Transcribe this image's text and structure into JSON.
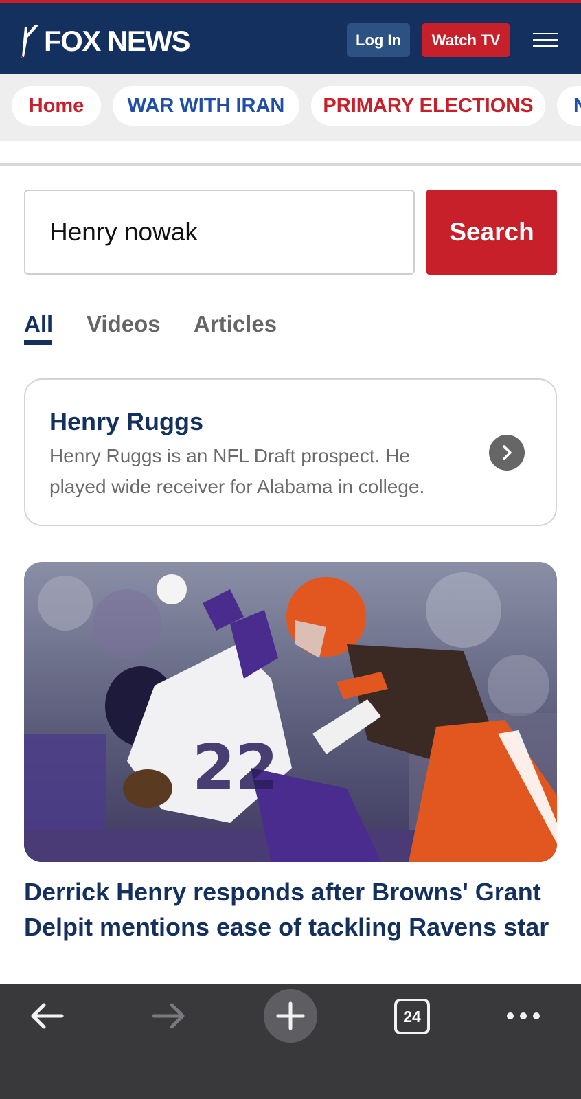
{
  "header": {
    "logo_text": "FOX NEWS",
    "login_label": "Log In",
    "watch_label": "Watch TV"
  },
  "nav": {
    "items": [
      {
        "label": "Home",
        "color": "#c8202a"
      },
      {
        "label": "WAR WITH IRAN",
        "color": "#1f4fa8"
      },
      {
        "label": "PRIMARY ELECTIONS",
        "color": "#c8202a"
      },
      {
        "label": "N",
        "color": "#1f4fa8"
      }
    ]
  },
  "search": {
    "value": "Henry nowak",
    "button_label": "Search"
  },
  "tabs": [
    {
      "label": "All",
      "active": true
    },
    {
      "label": "Videos",
      "active": false
    },
    {
      "label": "Articles",
      "active": false
    }
  ],
  "topic_card": {
    "title": "Henry Ruggs",
    "description": "Henry Ruggs is an NFL Draft prospect. He played wide receiver for Alabama in college."
  },
  "article": {
    "title": "Derrick Henry responds after Browns' Grant Delpit mentions ease of tackling Ravens star"
  },
  "browser_bar": {
    "tab_count": "24"
  },
  "colors": {
    "navy": "#13305e",
    "red": "#c8202a",
    "nav_bg": "#eeeeee",
    "bottom_bar": "#39393c"
  }
}
